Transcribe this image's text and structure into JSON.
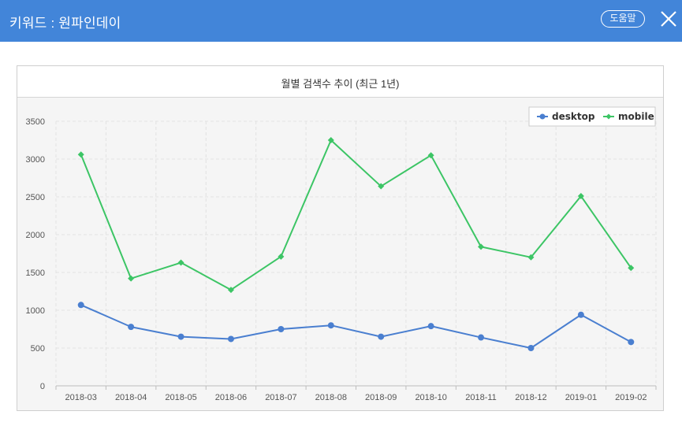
{
  "header": {
    "title": "키워드 : 원파인데이",
    "help_label": "도움말",
    "close_icon": "close-icon"
  },
  "panel": {
    "title": "월별 검색수 추이 (최근 1년)"
  },
  "colors": {
    "header_bg": "#4285d9",
    "desktop": "#4a7fd0",
    "mobile": "#3cc565"
  },
  "chart_data": {
    "type": "line",
    "title": "월별 검색수 추이 (최근 1년)",
    "xlabel": "",
    "ylabel": "",
    "categories": [
      "2018-03",
      "2018-04",
      "2018-05",
      "2018-06",
      "2018-07",
      "2018-08",
      "2018-09",
      "2018-10",
      "2018-11",
      "2018-12",
      "2019-01",
      "2019-02"
    ],
    "y_ticks": [
      0,
      500,
      1000,
      1500,
      2000,
      2500,
      3000,
      3500
    ],
    "ylim": [
      0,
      3500
    ],
    "grid": true,
    "legend_position": "top-right",
    "series": [
      {
        "name": "desktop",
        "marker": "circle",
        "values": [
          1070,
          780,
          650,
          620,
          750,
          800,
          650,
          790,
          640,
          500,
          940,
          580
        ]
      },
      {
        "name": "mobile",
        "marker": "diamond",
        "values": [
          3060,
          1420,
          1630,
          1270,
          1710,
          3250,
          2640,
          3050,
          1840,
          1700,
          2510,
          1560
        ]
      }
    ]
  }
}
